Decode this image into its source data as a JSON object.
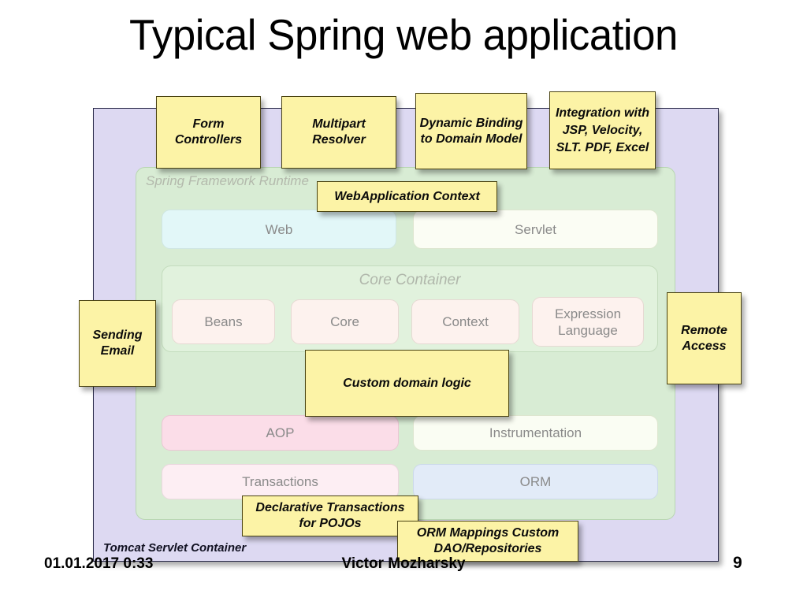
{
  "slide": {
    "title": "Typical Spring web application",
    "page_number": "9"
  },
  "footer": {
    "date": "01.01.2017 0:33",
    "author": "Victor Mozharsky"
  },
  "diagram": {
    "outer_container_label": "Tomcat Servlet Container",
    "runtime_label": "Spring Framework Runtime",
    "core_container_label": "Core Container",
    "modules": {
      "web": "Web",
      "servlet": "Servlet",
      "beans": "Beans",
      "core": "Core",
      "context": "Context",
      "expression_language": "Expression Language",
      "aop": "AOP",
      "instrumentation": "Instrumentation",
      "transactions": "Transactions",
      "orm": "ORM"
    },
    "notes": {
      "form_controllers": "Form Controllers",
      "multipart_resolver": "Multipart Resolver",
      "dynamic_binding": "Dynamic Binding to Domain Model",
      "integration": "Integration with JSP, Velocity, SLT. PDF, Excel",
      "webapplication_context": "WebApplication Context",
      "sending_email": "Sending Email",
      "remote_access": "Remote Access",
      "custom_domain_logic": "Custom domain logic",
      "declarative_transactions": "Declarative Transactions for POJOs",
      "orm_mappings": "ORM Mappings Custom DAO/Repositories"
    }
  },
  "colors": {
    "note_fill": "#fcf3a6",
    "note_border": "#4b4412",
    "outer_container_fill": "#ddd9f2",
    "runtime_fill": "#d8ecd4",
    "core_container_fill": "#e1f2dd",
    "web_fill": "#e2f7f8",
    "aop_fill": "#fbdde8",
    "orm_fill": "#e2ebf8"
  }
}
